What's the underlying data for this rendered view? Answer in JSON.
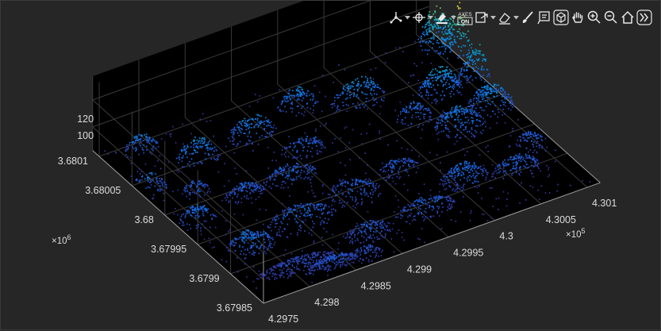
{
  "toolbar": {
    "items": [
      {
        "name": "data-tips-icon",
        "dropdown": true
      },
      {
        "name": "rotate-center-icon",
        "dropdown": true
      },
      {
        "name": "brush-icon",
        "dropdown": true
      },
      {
        "name": "axes-on-icon",
        "text_top": "AXES",
        "text_bottom": "ON",
        "dropdown": false
      },
      {
        "name": "export-icon",
        "dropdown": true
      },
      {
        "name": "eraser-icon",
        "dropdown": true
      },
      {
        "name": "paintbrush-icon",
        "dropdown": false
      },
      {
        "name": "datatip-icon",
        "dropdown": false
      },
      {
        "name": "rotate-3d-icon",
        "dropdown": false
      },
      {
        "name": "pan-icon",
        "dropdown": false
      },
      {
        "name": "zoom-in-icon",
        "dropdown": false
      },
      {
        "name": "zoom-out-icon",
        "dropdown": false
      },
      {
        "name": "home-icon",
        "dropdown": false
      },
      {
        "name": "expand-icon",
        "dropdown": false
      }
    ]
  },
  "chart_data": {
    "type": "scatter",
    "subtype": "3d point cloud",
    "colormap": "parula",
    "background": "#000000",
    "grid": true,
    "x_ticks": [
      "4.2975",
      "4.298",
      "4.2985",
      "4.299",
      "4.2995",
      "4.3",
      "4.3005",
      "4.301"
    ],
    "x_exponent_base": "×10",
    "x_exponent_power": "5",
    "y_ticks": [
      "3.67985",
      "3.6799",
      "3.67995",
      "3.68",
      "3.68005",
      "3.6801"
    ],
    "y_exponent_base": "×10",
    "y_exponent_power": "6",
    "z_ticks": [
      "100",
      "120"
    ],
    "z_range": [
      80,
      125
    ],
    "clusters": [
      {
        "u": 0.16,
        "v": 0.12,
        "ru": 0.12,
        "rv": 0.04,
        "h": 0.12,
        "n": 260
      },
      {
        "u": 0.24,
        "v": 0.06,
        "ru": 0.08,
        "rv": 0.03,
        "h": 0.18,
        "n": 220
      },
      {
        "u": 0.34,
        "v": 0.05,
        "ru": 0.05,
        "rv": 0.04,
        "h": 0.15,
        "n": 90
      },
      {
        "u": 0.4,
        "v": 0.15,
        "ru": 0.07,
        "rv": 0.05,
        "h": 0.18,
        "n": 150
      },
      {
        "u": 0.58,
        "v": 0.16,
        "ru": 0.09,
        "rv": 0.05,
        "h": 0.22,
        "n": 160
      },
      {
        "u": 0.74,
        "v": 0.24,
        "ru": 0.07,
        "rv": 0.06,
        "h": 0.28,
        "n": 180
      },
      {
        "u": 0.88,
        "v": 0.2,
        "ru": 0.07,
        "rv": 0.05,
        "h": 0.25,
        "n": 150
      },
      {
        "u": 0.98,
        "v": 0.3,
        "ru": 0.04,
        "rv": 0.06,
        "h": 0.2,
        "n": 90
      },
      {
        "u": 0.1,
        "v": 0.28,
        "ru": 0.07,
        "rv": 0.06,
        "h": 0.3,
        "n": 170
      },
      {
        "u": 0.28,
        "v": 0.32,
        "ru": 0.1,
        "rv": 0.08,
        "h": 0.25,
        "n": 180
      },
      {
        "u": 0.46,
        "v": 0.36,
        "ru": 0.08,
        "rv": 0.07,
        "h": 0.22,
        "n": 140
      },
      {
        "u": 0.62,
        "v": 0.4,
        "ru": 0.06,
        "rv": 0.05,
        "h": 0.2,
        "n": 110
      },
      {
        "u": 0.22,
        "v": 0.55,
        "ru": 0.06,
        "rv": 0.04,
        "h": 0.22,
        "n": 130
      },
      {
        "u": 0.36,
        "v": 0.55,
        "ru": 0.08,
        "rv": 0.05,
        "h": 0.25,
        "n": 140
      },
      {
        "u": 0.05,
        "v": 0.5,
        "ru": 0.05,
        "rv": 0.06,
        "h": 0.28,
        "n": 110
      },
      {
        "u": 0.86,
        "v": 0.5,
        "ru": 0.07,
        "rv": 0.08,
        "h": 0.35,
        "n": 200
      },
      {
        "u": 0.98,
        "v": 0.55,
        "ru": 0.06,
        "rv": 0.07,
        "h": 0.38,
        "n": 180
      },
      {
        "u": 0.9,
        "v": 0.7,
        "ru": 0.06,
        "rv": 0.06,
        "h": 0.45,
        "n": 200
      },
      {
        "u": 1.03,
        "v": 0.72,
        "ru": 0.06,
        "rv": 0.05,
        "h": 0.5,
        "n": 200
      },
      {
        "u": 1.08,
        "v": 0.85,
        "ru": 0.1,
        "rv": 0.08,
        "h": 0.95,
        "n": 480
      },
      {
        "u": 1.0,
        "v": 0.92,
        "ru": 0.05,
        "rv": 0.06,
        "h": 0.7,
        "n": 180
      },
      {
        "u": 0.7,
        "v": 0.8,
        "ru": 0.08,
        "rv": 0.06,
        "h": 0.4,
        "n": 160
      },
      {
        "u": 0.55,
        "v": 0.88,
        "ru": 0.06,
        "rv": 0.05,
        "h": 0.35,
        "n": 110
      },
      {
        "u": 0.38,
        "v": 0.82,
        "ru": 0.07,
        "rv": 0.06,
        "h": 0.35,
        "n": 140
      },
      {
        "u": 0.2,
        "v": 0.8,
        "ru": 0.06,
        "rv": 0.06,
        "h": 0.38,
        "n": 130
      },
      {
        "u": 0.1,
        "v": 0.94,
        "ru": 0.05,
        "rv": 0.04,
        "h": 0.32,
        "n": 90
      },
      {
        "u": 0.02,
        "v": 0.74,
        "ru": 0.05,
        "rv": 0.06,
        "h": 0.3,
        "n": 90
      },
      {
        "u": 0.46,
        "v": 0.66,
        "ru": 0.06,
        "rv": 0.05,
        "h": 0.25,
        "n": 100
      },
      {
        "u": 0.12,
        "v": 0.65,
        "ru": 0.04,
        "rv": 0.04,
        "h": 0.2,
        "n": 70
      },
      {
        "u": 0.78,
        "v": 0.62,
        "ru": 0.05,
        "rv": 0.05,
        "h": 0.3,
        "n": 90
      }
    ]
  }
}
